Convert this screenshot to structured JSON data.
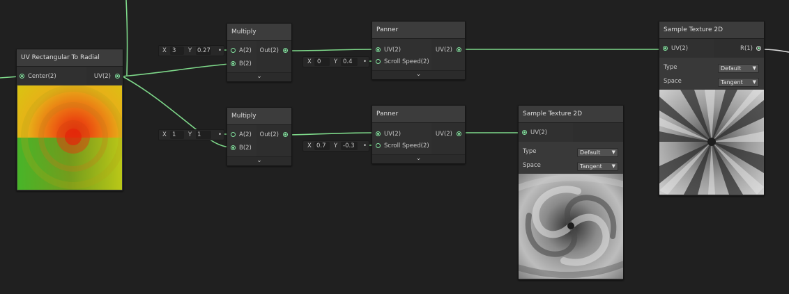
{
  "nodes": {
    "uv_radial": {
      "title": "UV Rectangular To Radial",
      "inputs": [
        "Center(2)"
      ],
      "outputs": [
        "UV(2)"
      ],
      "preview": "uv-gradient-preview"
    },
    "multiply_top": {
      "title": "Multiply",
      "inputs": [
        "A(2)",
        "B(2)"
      ],
      "outputs": [
        "Out(2)"
      ],
      "input_a": {
        "x_label": "X",
        "x_value": "3",
        "y_label": "Y",
        "y_value": "0.27"
      }
    },
    "multiply_bottom": {
      "title": "Multiply",
      "inputs": [
        "A(2)",
        "B(2)"
      ],
      "outputs": [
        "Out(2)"
      ],
      "input_a": {
        "x_label": "X",
        "x_value": "1",
        "y_label": "Y",
        "y_value": "1"
      }
    },
    "panner_top": {
      "title": "Panner",
      "inputs": [
        "UV(2)",
        "Scroll Speed(2)"
      ],
      "outputs": [
        "UV(2)"
      ],
      "scroll_speed": {
        "x_label": "X",
        "x_value": "0",
        "y_label": "Y",
        "y_value": "0.4"
      }
    },
    "panner_bottom": {
      "title": "Panner",
      "inputs": [
        "UV(2)",
        "Scroll Speed(2)"
      ],
      "outputs": [
        "UV(2)"
      ],
      "scroll_speed": {
        "x_label": "X",
        "x_value": "0.7",
        "y_label": "Y",
        "y_value": "-0.3"
      }
    },
    "sample_top": {
      "title": "Sample Texture 2D",
      "inputs": [
        "UV(2)"
      ],
      "outputs": [
        "R(1)"
      ],
      "type_label": "Type",
      "type_value": "Default",
      "space_label": "Space",
      "space_value": "Tangent",
      "preview": "radial-streaks-preview"
    },
    "sample_bottom": {
      "title": "Sample Texture 2D",
      "inputs": [
        "UV(2)"
      ],
      "type_label": "Type",
      "type_value": "Default",
      "space_label": "Space",
      "space_value": "Tangent",
      "preview": "swirl-cloud-preview"
    }
  },
  "colors": {
    "wire": "#7ed98a",
    "background": "#202020",
    "node_body": "#393939",
    "port": "#84e4a0"
  }
}
